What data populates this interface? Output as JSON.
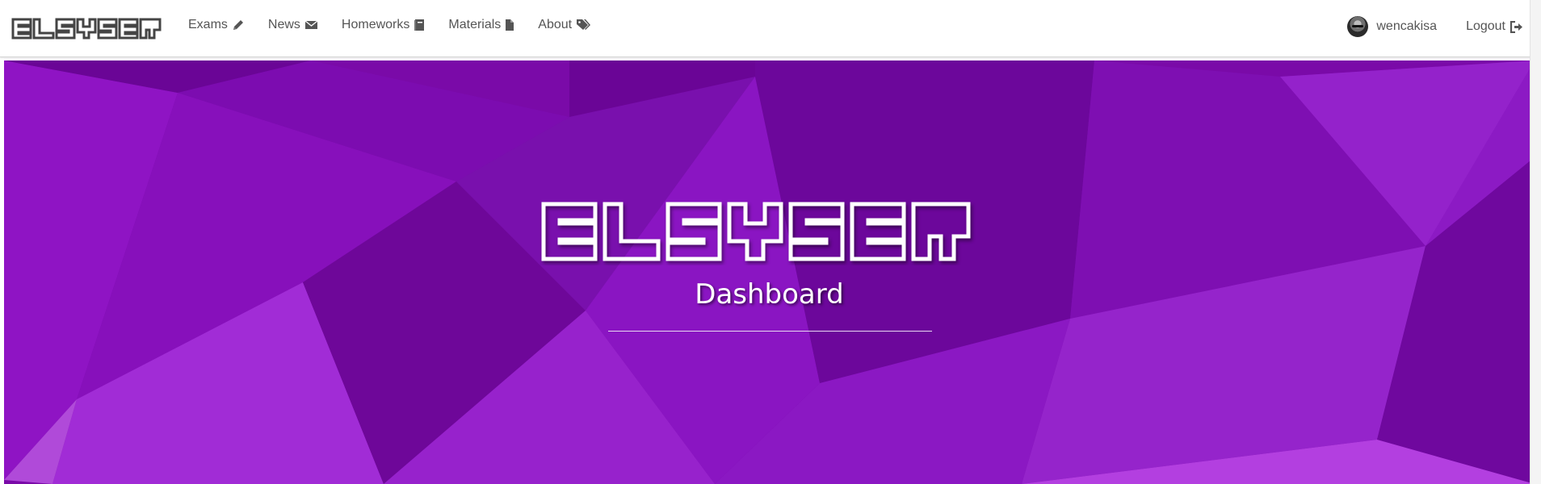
{
  "brand": {
    "text": "ELSYSER"
  },
  "nav": {
    "items": [
      {
        "label": "Exams",
        "icon": "pencil-icon"
      },
      {
        "label": "News",
        "icon": "envelope-icon"
      },
      {
        "label": "Homeworks",
        "icon": "book-icon"
      },
      {
        "label": "Materials",
        "icon": "file-icon"
      },
      {
        "label": "About",
        "icon": "tags-icon"
      }
    ]
  },
  "user": {
    "username": "wencakisa",
    "logout_label": "Logout",
    "logout_icon": "sign-out-icon"
  },
  "hero": {
    "logo_text": "ELSYSER",
    "title": "Dashboard"
  },
  "colors": {
    "hero_purple": "#7a0aa8",
    "nav_text": "#555555"
  }
}
